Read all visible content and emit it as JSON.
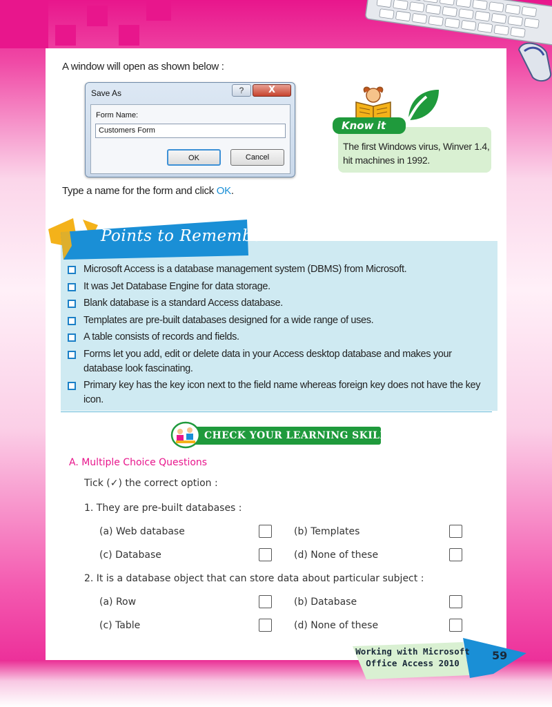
{
  "intro_text": "A window will open as shown below :",
  "dialog": {
    "title": "Save As",
    "help_label": "?",
    "close_label": "X",
    "field_label": "Form Name:",
    "field_value": "Customers Form",
    "ok_label": "OK",
    "cancel_label": "Cancel"
  },
  "instruction": {
    "before": "Type a name for the form and click ",
    "ok": "OK",
    "after": "."
  },
  "know_it": {
    "tag": "Know it",
    "text": "The first Windows virus, Winver 1.4, hit machines in 1992."
  },
  "points_to_remember": {
    "title": "Points to Remember",
    "items": [
      "Microsoft Access is a database management system (DBMS) from Microsoft.",
      "It was Jet Database Engine for data storage.",
      "Blank database is a standard Access database.",
      "Templates are pre-built databases designed for a wide range of uses.",
      "A table consists of records and fields.",
      "Forms let you add, edit or delete data in your Access desktop database and makes your database look fascinating.",
      "Primary key has the key icon next to the field name whereas foreign key does not have the key icon."
    ]
  },
  "skills": {
    "title": "CHECK YOUR LEARNING SKILLS"
  },
  "section_a": {
    "heading": "A.  Multiple Choice Questions",
    "instruction": "Tick (✓) the correct option :",
    "questions": [
      {
        "text": "1.  They are pre-built databases :",
        "options": [
          "(a)  Web database",
          "(b)  Templates",
          "(c)  Database",
          "(d)  None of these"
        ]
      },
      {
        "text": "2.  It is a database object that can store data about particular subject :",
        "options": [
          "(a)  Row",
          "(b)  Database",
          "(c)  Table",
          "(d)  None of these"
        ]
      }
    ]
  },
  "footer": {
    "line1": "Working with Microsoft",
    "line2": "Office Access 2010",
    "page_number": "59"
  },
  "colors": {
    "magenta": "#e8168c",
    "green": "#1f9a3c",
    "blue": "#1a7fc7",
    "light_blue": "#cfeaf2",
    "light_green": "#d9f0d2"
  }
}
